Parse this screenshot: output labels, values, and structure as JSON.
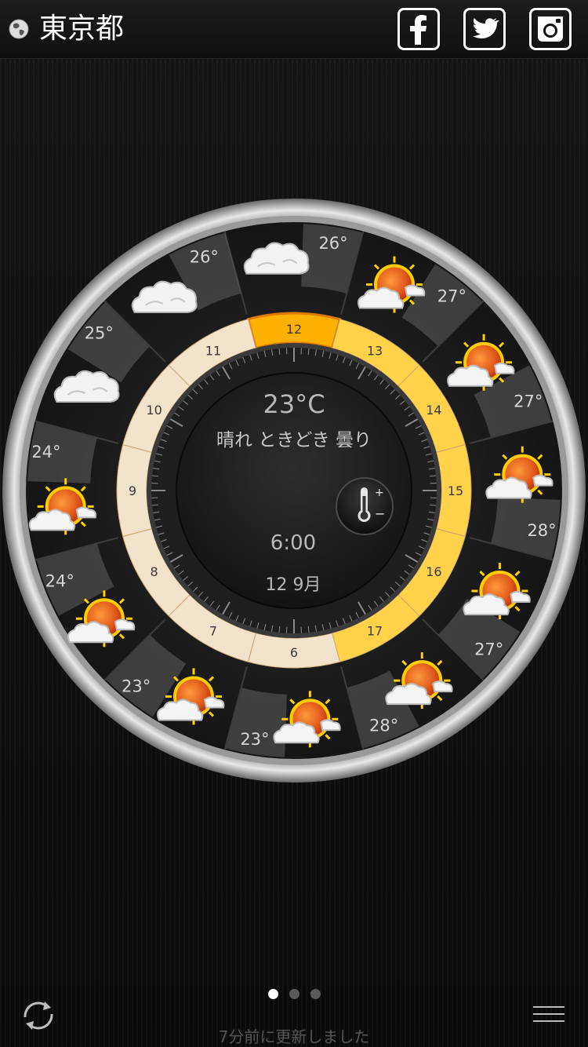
{
  "header": {
    "location": "東京都",
    "location_icon": "globe-icon",
    "social": [
      {
        "name": "facebook",
        "icon": "facebook-icon"
      },
      {
        "name": "twitter",
        "icon": "twitter-icon"
      },
      {
        "name": "instagram",
        "icon": "instagram-icon"
      }
    ]
  },
  "center": {
    "temperature": "23°C",
    "condition": "晴れ ときどき 曇り",
    "time": "6:00",
    "date": "12 9月",
    "unit_toggle_icon": "thermometer-icon"
  },
  "hours": [
    {
      "hour": "12",
      "temp": "26°",
      "icon": "cloud-icon",
      "selected": true
    },
    {
      "hour": "13",
      "temp": "27°",
      "icon": "sun-cloud-icon",
      "selected": false
    },
    {
      "hour": "14",
      "temp": "27°",
      "icon": "sun-cloud-icon",
      "selected": false
    },
    {
      "hour": "15",
      "temp": "28°",
      "icon": "sun-cloud-icon",
      "selected": false
    },
    {
      "hour": "16",
      "temp": "27°",
      "icon": "sun-cloud-icon",
      "selected": false
    },
    {
      "hour": "17",
      "temp": "28°",
      "icon": "sun-cloud-icon",
      "selected": false
    },
    {
      "hour": "6",
      "temp": "23°",
      "icon": "sun-cloud-icon",
      "selected": false
    },
    {
      "hour": "7",
      "temp": "23°",
      "icon": "sun-cloud-icon",
      "selected": false
    },
    {
      "hour": "8",
      "temp": "24°",
      "icon": "sun-cloud-icon",
      "selected": false
    },
    {
      "hour": "9",
      "temp": "24°",
      "icon": "sun-cloud-icon",
      "selected": false
    },
    {
      "hour": "10",
      "temp": "25°",
      "icon": "cloud-icon",
      "selected": false
    },
    {
      "hour": "11",
      "temp": "26°",
      "icon": "cloud-icon",
      "selected": false
    }
  ],
  "pager": {
    "pages": 3,
    "active": 0
  },
  "footer": {
    "refresh_icon": "refresh-icon",
    "menu_icon": "menu-icon",
    "updated_text": "7分前に更新しました"
  },
  "colors": {
    "selected_ring": "#ffb000",
    "ring_warm": "#ffd24a",
    "ring_cool": "#f2e3cc",
    "bezel": "#d4d4d4"
  }
}
